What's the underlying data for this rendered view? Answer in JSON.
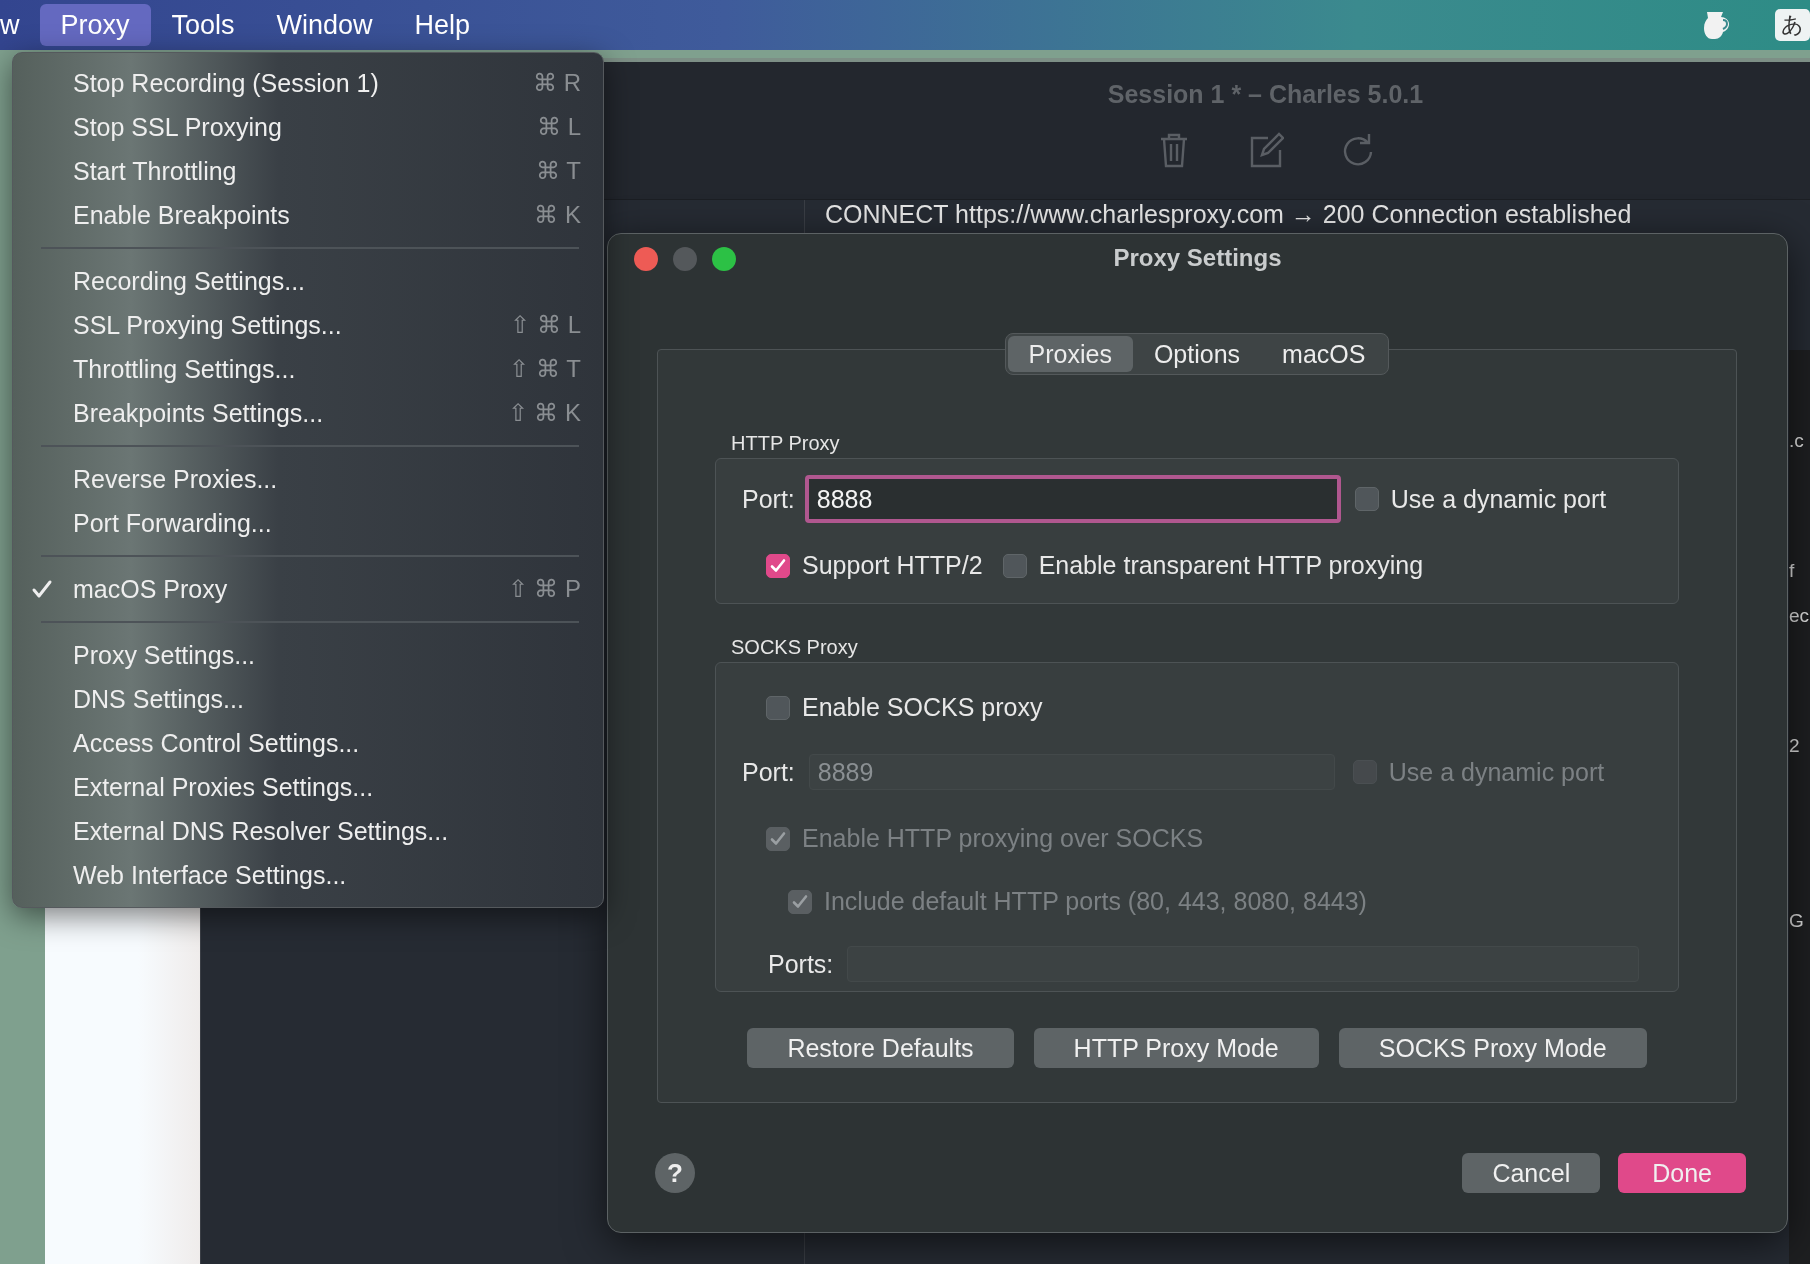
{
  "menu_bar": {
    "items": [
      {
        "label": "w",
        "selected": false
      },
      {
        "label": "Proxy",
        "selected": true
      },
      {
        "label": "Tools",
        "selected": false
      },
      {
        "label": "Window",
        "selected": false
      },
      {
        "label": "Help",
        "selected": false
      }
    ],
    "input_method": "あ"
  },
  "proxy_menu": {
    "items": [
      {
        "kind": "item",
        "label": "Stop Recording (Session 1)",
        "shortcut": "⌘ R",
        "checked": false
      },
      {
        "kind": "item",
        "label": "Stop SSL Proxying",
        "shortcut": "⌘ L",
        "checked": false
      },
      {
        "kind": "item",
        "label": "Start Throttling",
        "shortcut": "⌘ T",
        "checked": false
      },
      {
        "kind": "item",
        "label": "Enable Breakpoints",
        "shortcut": "⌘ K",
        "checked": false
      },
      {
        "kind": "separator"
      },
      {
        "kind": "item",
        "label": "Recording Settings...",
        "checked": false
      },
      {
        "kind": "item",
        "label": "SSL Proxying Settings...",
        "shortcut": "⇧ ⌘ L",
        "checked": false
      },
      {
        "kind": "item",
        "label": "Throttling Settings...",
        "shortcut": "⇧ ⌘ T",
        "checked": false
      },
      {
        "kind": "item",
        "label": "Breakpoints Settings...",
        "shortcut": "⇧ ⌘ K",
        "checked": false
      },
      {
        "kind": "separator"
      },
      {
        "kind": "item",
        "label": "Reverse Proxies...",
        "checked": false
      },
      {
        "kind": "item",
        "label": "Port Forwarding...",
        "checked": false
      },
      {
        "kind": "separator"
      },
      {
        "kind": "item",
        "label": "macOS Proxy",
        "shortcut": "⇧ ⌘ P",
        "checked": true
      },
      {
        "kind": "separator"
      },
      {
        "kind": "item",
        "label": "Proxy Settings...",
        "checked": false
      },
      {
        "kind": "item",
        "label": "DNS Settings...",
        "checked": false
      },
      {
        "kind": "item",
        "label": "Access Control Settings...",
        "checked": false
      },
      {
        "kind": "item",
        "label": "External Proxies Settings...",
        "checked": false
      },
      {
        "kind": "item",
        "label": "External DNS Resolver Settings...",
        "checked": false
      },
      {
        "kind": "item",
        "label": "Web Interface Settings...",
        "checked": false
      }
    ]
  },
  "background_window": {
    "title": "Session 1 * – Charles 5.0.1",
    "log_line": "CONNECT https://www.charlesproxy.com → 200 Connection established",
    "edge_fragments": [
      ".c",
      "f",
      "ec",
      "2",
      "G"
    ]
  },
  "dialog": {
    "title": "Proxy Settings",
    "tabs": [
      {
        "label": "Proxies",
        "selected": true
      },
      {
        "label": "Options",
        "selected": false
      },
      {
        "label": "macOS",
        "selected": false
      }
    ],
    "http_proxy": {
      "heading": "HTTP Proxy",
      "port_label": "Port:",
      "port_value": "8888",
      "port_focused": true,
      "dynamic_port": {
        "label": "Use a dynamic port",
        "checked": false,
        "disabled": false
      },
      "options": [
        {
          "label": "Support HTTP/2",
          "checked": true,
          "disabled": false
        },
        {
          "label": "Enable transparent HTTP proxying",
          "checked": false,
          "disabled": false
        }
      ]
    },
    "socks_proxy": {
      "heading": "SOCKS Proxy",
      "enable": {
        "label": "Enable SOCKS proxy",
        "checked": false,
        "disabled": false
      },
      "port_label": "Port:",
      "port_value": "8889",
      "port_disabled": true,
      "dynamic_port": {
        "label": "Use a dynamic port",
        "checked": false,
        "disabled": true
      },
      "http_over_socks": {
        "label": "Enable HTTP proxying over SOCKS",
        "checked": true,
        "disabled": true
      },
      "default_ports": {
        "label": "Include default HTTP ports (80, 443, 8080, 8443)",
        "checked": true,
        "disabled": true
      },
      "ports_label": "Ports:",
      "ports_disabled": true
    },
    "mode_buttons": [
      "Restore Defaults",
      "HTTP Proxy Mode",
      "SOCKS Proxy Mode"
    ],
    "footer_buttons": [
      {
        "label": "Cancel",
        "kind": "normal"
      },
      {
        "label": "Done",
        "kind": "primary"
      }
    ],
    "help_label": "?"
  }
}
